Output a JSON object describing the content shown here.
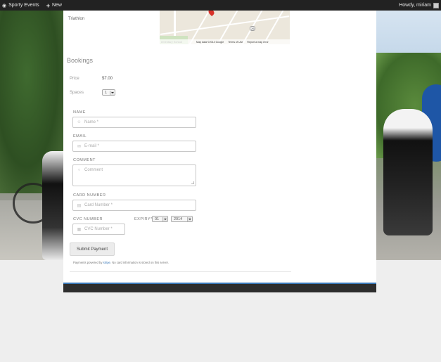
{
  "adminbar": {
    "site_name": "Sporty Events",
    "new_label": "New",
    "howdy": "Howdy, miriam"
  },
  "event": {
    "location_label": "Triathlon"
  },
  "map": {
    "route_shield": "26",
    "attribution": "Map data ©2014 Google",
    "terms": "Terms of Use",
    "report": "Report a map error",
    "partial_label": "ementary School"
  },
  "bookings": {
    "heading": "Bookings",
    "price_label": "Price",
    "price_value": "$7.00",
    "spaces_label": "Spaces",
    "spaces_value": "1"
  },
  "form": {
    "name_label": "NAME",
    "name_placeholder": "Name *",
    "email_label": "EMAIL",
    "email_placeholder": "E-mail *",
    "comment_label": "COMMENT",
    "comment_placeholder": "Comment",
    "card_label": "CARD NUMBER",
    "card_placeholder": "Card Number *",
    "cvc_label": "CVC NUMBER",
    "cvc_placeholder": "CVC Number *",
    "expiry_label": "EXPIRY*",
    "expiry_month": "01",
    "expiry_year": "2014",
    "submit": "Submit Payment",
    "powered_pre": "Payments powered by",
    "powered_link": "stripe",
    "powered_post": "No card information is stored on this server."
  },
  "colors": {
    "admin_bar": "#222222",
    "accent": "#3a78b8",
    "footer": "#2d2d2d"
  }
}
